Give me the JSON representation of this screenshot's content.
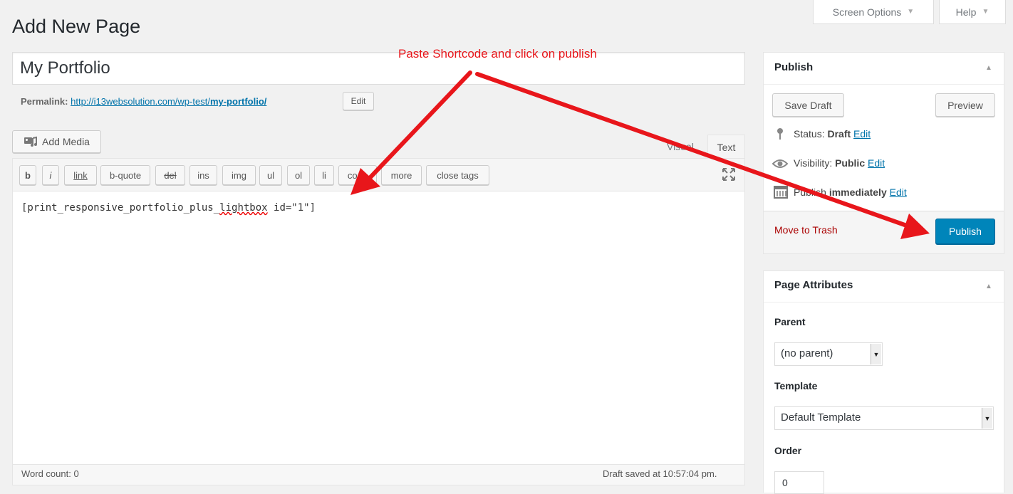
{
  "header": {
    "title": "Add New Page",
    "screen_options": "Screen Options",
    "help": "Help",
    "arrow": "▼"
  },
  "editor": {
    "post_title": "My Portfolio",
    "permalink_label": "Permalink:",
    "permalink_base": "http://i13websolution.com/wp-test/",
    "permalink_slug": "my-portfolio/",
    "permalink_edit": "Edit",
    "add_media": "Add Media",
    "tab_visual": "Visual",
    "tab_text": "Text",
    "quicktags": [
      "b",
      "i",
      "link",
      "b-quote",
      "del",
      "ins",
      "img",
      "ul",
      "ol",
      "li",
      "code",
      "more",
      "close tags"
    ],
    "content_before": "[print_responsive_portfolio_plus_",
    "content_mark": "lightbox",
    "content_after": " id=\"1\"]",
    "word_count": "Word count: 0",
    "draft_saved": "Draft saved at 10:57:04 pm."
  },
  "annotation": {
    "text": "Paste Shortcode and click on publish",
    "color": "#e8161b"
  },
  "publish": {
    "title": "Publish",
    "save_draft": "Save Draft",
    "preview": "Preview",
    "status_label": "Status:",
    "status_value": "Draft",
    "visibility_label": "Visibility:",
    "visibility_value": "Public",
    "schedule_label": "Publish",
    "schedule_value": "immediately",
    "edit": "Edit",
    "trash": "Move to Trash",
    "publish_button": "Publish"
  },
  "attributes": {
    "title": "Page Attributes",
    "parent_label": "Parent",
    "parent_value": "(no parent)",
    "template_label": "Template",
    "template_value": "Default Template",
    "order_label": "Order",
    "order_value": "0"
  },
  "colors": {
    "accent": "#0073aa",
    "publish_bg": "#0085ba",
    "trash": "#a00"
  }
}
